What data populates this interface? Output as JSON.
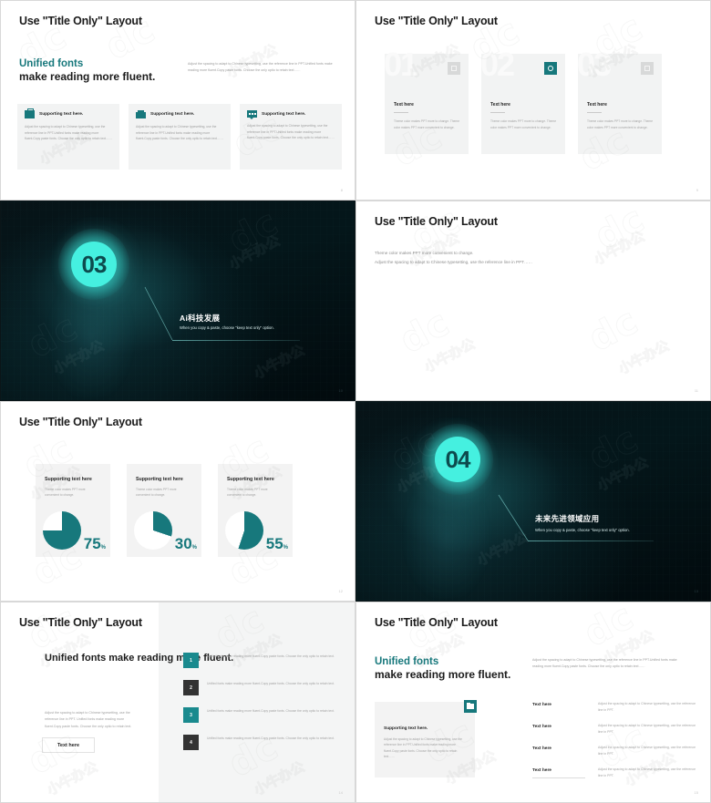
{
  "theme": {
    "teal": "#17787c",
    "teal_badge": "#1a8a8e",
    "dark_badge": "#333333",
    "cyan_glow": "#45f0e0",
    "card_bg": "#f2f3f3",
    "body_text": "#a0a0a0",
    "heading_text": "#1b1b1b"
  },
  "watermark": {
    "glyph": "dc",
    "text": "小牛办公"
  },
  "slides": [
    {
      "id": "slide-1",
      "kind": "three-icon-cards",
      "title": "Use \"Title Only\" Layout",
      "page_number": "8",
      "heading_line1": "Unified fonts",
      "heading_line2": "make reading more fluent.",
      "paragraph": "Adjust the spacing to adapt to Chinese typesetting, use the reference line in PPT.Unified fonts make reading more fluent.Copy paste fonts. Choose the only optio to retain text……",
      "cards": [
        {
          "icon": "toolbox-icon",
          "title": "Supporting text here.",
          "body": "Adjust the spacing to adapt to Chinese typesetting, use the reference line in PPT.Unified fonts make reading more fluent.Copy paste fonts. Choose the only optio to retain text……"
        },
        {
          "icon": "sofa-icon",
          "title": "Supporting text here.",
          "body": "Adjust the spacing to adapt to Chinese typesetting, use the reference line in PPT.Unified fonts make reading more fluent.Copy paste fonts. Choose the only optio to retain text……"
        },
        {
          "icon": "chat-icon",
          "title": "Supporting text here.",
          "body": "Adjust the spacing to adapt to Chinese typesetting, use the reference line in PPT.Unified fonts make reading more fluent.Copy paste fonts. Choose the only optio to retain text……"
        }
      ]
    },
    {
      "id": "slide-2",
      "kind": "numbered-cards",
      "title": "Use \"Title Only\" Layout",
      "page_number": "9",
      "cards": [
        {
          "number": "01",
          "badge_icon": "search-icon",
          "badge_style": "gray",
          "title": "Text here",
          "body": "Theme  color makes PPT more to change. Theme  color makes PPT more convenient to change."
        },
        {
          "number": "02",
          "badge_icon": "gear-icon",
          "badge_style": "teal",
          "title": "Text here",
          "body": "Theme  color makes PPT more to change. Theme  color makes PPT more convenient to change."
        },
        {
          "number": "03",
          "badge_icon": "window-icon",
          "badge_style": "gray",
          "title": "Text here",
          "body": "Theme  color makes PPT more to change. Theme  color makes PPT more convenient to change."
        }
      ]
    },
    {
      "id": "slide-3",
      "kind": "dark-section",
      "page_number": "10",
      "number": "03",
      "heading": "Ai科技发展",
      "subheading": "When you copy & paste, choose \"keep text only\" option."
    },
    {
      "id": "slide-4",
      "kind": "title-only",
      "title": "Use \"Title Only\" Layout",
      "page_number": "11",
      "line1": "Theme color makes PPT more convenient to change.",
      "line2": "Adjust the spacing to adapt to Chinese typesetting, use the reference line in PPT……"
    },
    {
      "id": "slide-5",
      "kind": "pie-cards",
      "title": "Use \"Title Only\" Layout",
      "page_number": "12",
      "cards": [
        {
          "title": "Supporting text here",
          "body": "Theme  color makes PPT more convenient to change.",
          "percent": "75",
          "unit": "%"
        },
        {
          "title": "Supporting text here",
          "body": "Theme  color makes PPT more convenient to change.",
          "percent": "30",
          "unit": "%"
        },
        {
          "title": "Supporting text here",
          "body": "Theme  color makes PPT more convenient to change.",
          "percent": "55",
          "unit": "%"
        }
      ]
    },
    {
      "id": "slide-6",
      "kind": "dark-section",
      "page_number": "13",
      "number": "04",
      "heading": "未来先进领域应用",
      "subheading": "When you copy & paste, choose \"keep text only\" option."
    },
    {
      "id": "slide-7",
      "kind": "split-numbered-list",
      "title": "Use \"Title Only\" Layout",
      "page_number": "14",
      "heading": "Unified fonts make reading more fluent.",
      "paragraph": "Adjust the spacing to adapt to Chinese typesetting, use the reference line in PPT. Unified fonts make reading more fluent.Copy paste fonts. Choose the only optio to retain text.",
      "button_label": "Text here",
      "items": [
        {
          "number": "1",
          "style": "teal",
          "text": "Unified fonts make reading more fluent.Copy paste fonts. Choose the only optio to retain text."
        },
        {
          "number": "2",
          "style": "dark",
          "text": "Unified fonts make reading more fluent.Copy paste fonts. Choose the only optio to retain text."
        },
        {
          "number": "3",
          "style": "teal",
          "text": "Unified fonts make reading more fluent.Copy paste fonts. Choose the only optio to retain text."
        },
        {
          "number": "4",
          "style": "dark",
          "text": "Unified fonts make reading more fluent.Copy paste fonts. Choose the only optio to retain text."
        }
      ]
    },
    {
      "id": "slide-8",
      "kind": "card-and-rows",
      "title": "Use \"Title Only\" Layout",
      "page_number": "15",
      "heading_line1": "Unified fonts",
      "heading_line2": "make reading more fluent.",
      "paragraph": "Adjust the spacing to adapt to Chinese typesetting, use the reference line in PPT.Unified fonts make reading more fluent.Copy paste fonts. Choose the only optio to retain text……",
      "card": {
        "icon": "folder-icon",
        "title": "Supporting text here.",
        "body": "Adjust the spacing to adapt to Chinese typesetting, use the reference line in PPT.Unified fonts make reading more fluent.Copy paste fonts. Choose the only optio to retain text……"
      },
      "rows": [
        {
          "label": "Text here",
          "value": "Adjust the spacing to adapt to Chinese typesetting, use the reference line in PPT."
        },
        {
          "label": "Text here",
          "value": "Adjust the spacing to adapt to Chinese typesetting, use the reference line in PPT."
        },
        {
          "label": "Text here",
          "value": "Adjust the spacing to adapt to Chinese typesetting, use the reference line in PPT."
        },
        {
          "label": "Text here",
          "value": "Adjust the spacing to adapt to Chinese typesetting, use the reference line in PPT."
        }
      ]
    }
  ]
}
